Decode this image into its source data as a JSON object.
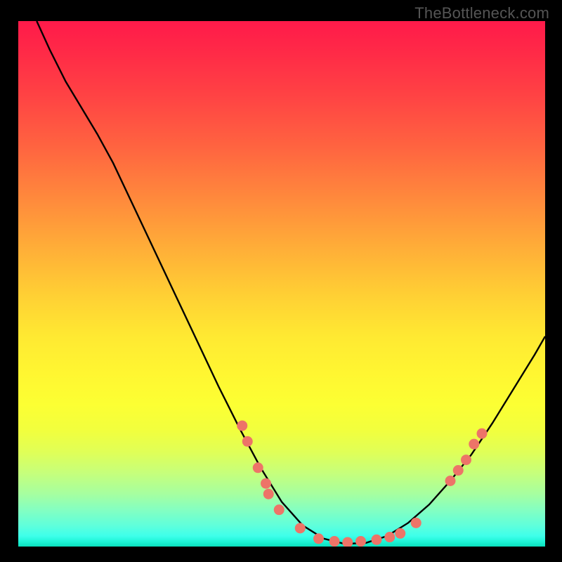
{
  "watermark": "TheBottleneck.com",
  "chart_data": {
    "type": "line",
    "title": "",
    "xlabel": "",
    "ylabel": "",
    "xlim": [
      0,
      100
    ],
    "ylim": [
      0,
      100
    ],
    "curve": [
      {
        "x": 3.5,
        "y": 100
      },
      {
        "x": 6.0,
        "y": 94.5
      },
      {
        "x": 9.0,
        "y": 88.5
      },
      {
        "x": 12.0,
        "y": 83.5
      },
      {
        "x": 15.0,
        "y": 78.5
      },
      {
        "x": 18.0,
        "y": 73.0
      },
      {
        "x": 22.0,
        "y": 64.5
      },
      {
        "x": 26.0,
        "y": 56.0
      },
      {
        "x": 30.0,
        "y": 47.5
      },
      {
        "x": 34.0,
        "y": 39.0
      },
      {
        "x": 38.0,
        "y": 30.5
      },
      {
        "x": 42.0,
        "y": 22.5
      },
      {
        "x": 46.0,
        "y": 15.0
      },
      {
        "x": 50.0,
        "y": 8.5
      },
      {
        "x": 54.0,
        "y": 4.0
      },
      {
        "x": 58.0,
        "y": 1.5
      },
      {
        "x": 62.0,
        "y": 0.5
      },
      {
        "x": 66.0,
        "y": 0.7
      },
      {
        "x": 70.0,
        "y": 2.0
      },
      {
        "x": 74.0,
        "y": 4.5
      },
      {
        "x": 78.0,
        "y": 8.0
      },
      {
        "x": 82.0,
        "y": 12.5
      },
      {
        "x": 86.0,
        "y": 17.5
      },
      {
        "x": 90.0,
        "y": 23.5
      },
      {
        "x": 94.0,
        "y": 30.0
      },
      {
        "x": 98.0,
        "y": 36.5
      },
      {
        "x": 100.0,
        "y": 40.0
      }
    ],
    "scatter_points": [
      {
        "x": 42.5,
        "y": 23.0
      },
      {
        "x": 43.5,
        "y": 20.0
      },
      {
        "x": 45.5,
        "y": 15.0
      },
      {
        "x": 47.0,
        "y": 12.0
      },
      {
        "x": 47.5,
        "y": 10.0
      },
      {
        "x": 49.5,
        "y": 7.0
      },
      {
        "x": 53.5,
        "y": 3.5
      },
      {
        "x": 57.0,
        "y": 1.5
      },
      {
        "x": 60.0,
        "y": 1.0
      },
      {
        "x": 62.5,
        "y": 0.8
      },
      {
        "x": 65.0,
        "y": 1.0
      },
      {
        "x": 68.0,
        "y": 1.3
      },
      {
        "x": 70.5,
        "y": 1.8
      },
      {
        "x": 72.5,
        "y": 2.5
      },
      {
        "x": 75.5,
        "y": 4.5
      },
      {
        "x": 82.0,
        "y": 12.5
      },
      {
        "x": 83.5,
        "y": 14.5
      },
      {
        "x": 85.0,
        "y": 16.5
      },
      {
        "x": 86.5,
        "y": 19.5
      },
      {
        "x": 88.0,
        "y": 21.5
      }
    ],
    "point_color": "#ed7468",
    "curve_color": "#000000"
  }
}
